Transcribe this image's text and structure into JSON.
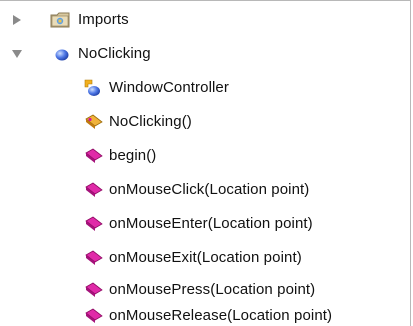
{
  "tree": {
    "imports": {
      "label": "Imports",
      "expanded": false,
      "icon": "package-folder-icon"
    },
    "class_node": {
      "label": "NoClicking",
      "expanded": true,
      "icon": "class-icon",
      "children": [
        {
          "label": "WindowController",
          "icon": "superclass-icon"
        },
        {
          "label": "NoClicking()",
          "icon": "constructor-icon"
        },
        {
          "label": "begin()",
          "icon": "method-icon"
        },
        {
          "label": "onMouseClick(Location point)",
          "icon": "method-icon"
        },
        {
          "label": "onMouseEnter(Location point)",
          "icon": "method-icon"
        },
        {
          "label": "onMouseExit(Location point)",
          "icon": "method-icon"
        },
        {
          "label": "onMousePress(Location point)",
          "icon": "method-icon"
        },
        {
          "label": "onMouseRelease(Location point)",
          "icon": "method-icon"
        }
      ]
    }
  },
  "colors": {
    "method": "#d6169e",
    "constructor": "#e8a020",
    "class": "#3b62d8",
    "disclosure": "#8a8a8a"
  }
}
